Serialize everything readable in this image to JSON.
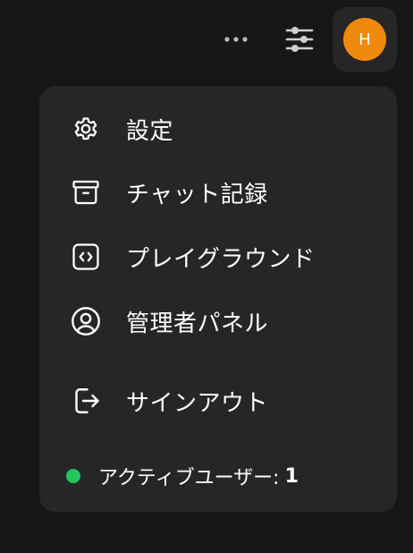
{
  "header": {
    "more_icon": "ellipsis-icon",
    "controls_icon": "sliders-icon",
    "avatar": {
      "initial": "H",
      "color": "#F08A0C"
    }
  },
  "menu": {
    "items": [
      {
        "label": "設定",
        "icon": "gear-icon"
      },
      {
        "label": "チャット記録",
        "icon": "archive-icon"
      },
      {
        "label": "プレイグラウンド",
        "icon": "code-icon"
      },
      {
        "label": "管理者パネル",
        "icon": "user-circle-icon"
      },
      {
        "label": "サインアウト",
        "icon": "sign-out-icon"
      }
    ],
    "status": {
      "label": "アクティブユーザー:",
      "count": "1",
      "dot_color": "#22C55E"
    }
  }
}
